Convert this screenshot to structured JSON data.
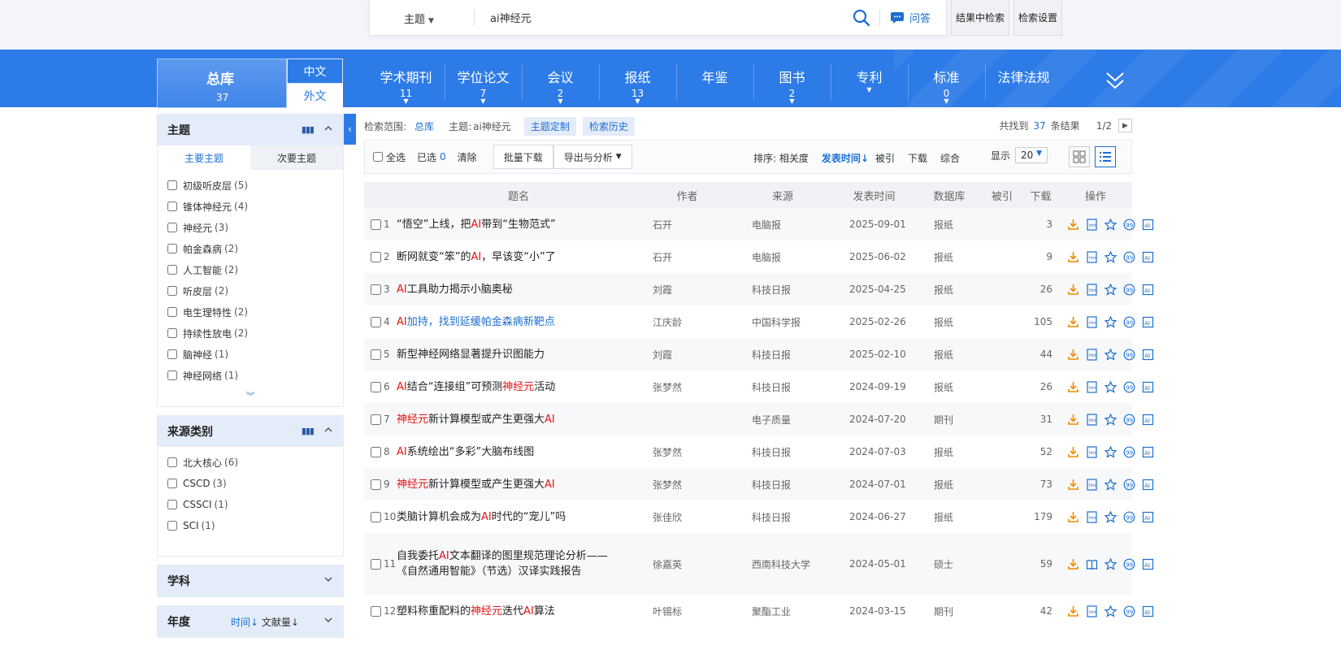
{
  "search": {
    "field": "主题",
    "query": "ai神经元",
    "qa_label": "问答",
    "in_results_label": "结果中检索",
    "settings_label": "检索设置"
  },
  "nav": {
    "all": {
      "name": "总库",
      "count": "37"
    },
    "lang_zh": "中文",
    "lang_en": "外文",
    "tabs": [
      {
        "name": "学术期刊",
        "count": "11"
      },
      {
        "name": "学位论文",
        "count": "7"
      },
      {
        "name": "会议",
        "count": "2"
      },
      {
        "name": "报纸",
        "count": "13"
      },
      {
        "name": "年鉴",
        "count": ""
      },
      {
        "name": "图书",
        "count": "2"
      },
      {
        "name": "专利",
        "count": ""
      },
      {
        "name": "标准",
        "count": "0"
      },
      {
        "name": "法律法规",
        "count": ""
      }
    ]
  },
  "left": {
    "topic": {
      "title": "主题",
      "tab_main": "主要主题",
      "tab_secondary": "次要主题",
      "items": [
        {
          "label": "初级听皮层",
          "count": "(5)"
        },
        {
          "label": "锥体神经元",
          "count": "(4)"
        },
        {
          "label": "神经元",
          "count": "(3)"
        },
        {
          "label": "帕金森病",
          "count": "(2)"
        },
        {
          "label": "人工智能",
          "count": "(2)"
        },
        {
          "label": "听皮层",
          "count": "(2)"
        },
        {
          "label": "电生理特性",
          "count": "(2)"
        },
        {
          "label": "持续性放电",
          "count": "(2)"
        },
        {
          "label": "脑神经",
          "count": "(1)"
        },
        {
          "label": "神经网络",
          "count": "(1)"
        }
      ]
    },
    "source": {
      "title": "来源类别",
      "items": [
        {
          "label": "北大核心",
          "count": "(6)"
        },
        {
          "label": "CSCD",
          "count": "(3)"
        },
        {
          "label": "CSSCI",
          "count": "(1)"
        },
        {
          "label": "SCI",
          "count": "(1)"
        }
      ]
    },
    "subject": {
      "title": "学科"
    },
    "year": {
      "title": "年度",
      "sort_time": "时间↓",
      "sort_count": "文献量↓"
    }
  },
  "main": {
    "crumbs": {
      "scope_label": "检索范围:",
      "scope_value": "总库",
      "topic_label": "主题:",
      "topic_value": "ai神经元",
      "tag_custom": "主题定制",
      "tag_history": "检索历史"
    },
    "result_prefix": "共找到",
    "result_count": "37",
    "result_suffix": "条结果",
    "page": "1/2",
    "toolbar": {
      "select_all": "全选",
      "selected_label": "已选",
      "selected_count": "0",
      "clear": "清除",
      "batch_download": "批量下载",
      "export": "导出与分析",
      "sort_label": "排序:",
      "sort_relevance": "相关度",
      "sort_date": "发表时间",
      "sort_cited": "被引",
      "sort_download": "下载",
      "sort_overall": "综合",
      "display_label": "显示",
      "display_value": "20"
    },
    "columns": [
      "题名",
      "作者",
      "来源",
      "发表时间",
      "数据库",
      "被引",
      "下载",
      "操作"
    ],
    "rows": [
      {
        "idx": "1",
        "title": [
          {
            "t": "“悟空”上线，把"
          },
          {
            "t": "AI",
            "hl": true
          },
          {
            "t": "带到“生物范式”"
          }
        ],
        "author": "石开",
        "source": "电脑报",
        "date": "2025-09-01",
        "db": "报纸",
        "cited": "",
        "downloads": "3"
      },
      {
        "idx": "2",
        "title": [
          {
            "t": "断网就变“笨”的"
          },
          {
            "t": "AI",
            "hl": true
          },
          {
            "t": "，早该变“小”了"
          }
        ],
        "author": "石开",
        "source": "电脑报",
        "date": "2025-06-02",
        "db": "报纸",
        "cited": "",
        "downloads": "9"
      },
      {
        "idx": "3",
        "title": [
          {
            "t": "AI",
            "hl": true
          },
          {
            "t": "工具助力揭示小脑奥秘"
          }
        ],
        "author": "刘霞",
        "source": "科技日报",
        "date": "2025-04-25",
        "db": "报纸",
        "cited": "",
        "downloads": "26"
      },
      {
        "idx": "4",
        "title": [
          {
            "t": "AI",
            "hl": true
          },
          {
            "t": "加持，找到延缓帕金森病新靶点"
          }
        ],
        "title_blue": true,
        "author": "江庆龄",
        "source": "中国科学报",
        "date": "2025-02-26",
        "db": "报纸",
        "cited": "",
        "downloads": "105"
      },
      {
        "idx": "5",
        "title": [
          {
            "t": "新型神经网络显著提升识图能力"
          }
        ],
        "author": "刘霞",
        "source": "科技日报",
        "date": "2025-02-10",
        "db": "报纸",
        "cited": "",
        "downloads": "44"
      },
      {
        "idx": "6",
        "title": [
          {
            "t": "AI",
            "hl": true
          },
          {
            "t": "结合“连接组”可预测"
          },
          {
            "t": "神经元",
            "hl": true
          },
          {
            "t": "活动"
          }
        ],
        "author": "张梦然",
        "source": "科技日报",
        "date": "2024-09-19",
        "db": "报纸",
        "cited": "",
        "downloads": "26"
      },
      {
        "idx": "7",
        "title": [
          {
            "t": "神经元",
            "hl": true
          },
          {
            "t": "新计算模型或产生更强大"
          },
          {
            "t": "AI",
            "hl": true
          }
        ],
        "author": "",
        "source": "电子质量",
        "date": "2024-07-20",
        "db": "期刊",
        "cited": "",
        "downloads": "31"
      },
      {
        "idx": "8",
        "title": [
          {
            "t": "AI",
            "hl": true
          },
          {
            "t": "系统绘出“多彩”大脑布线图"
          }
        ],
        "author": "张梦然",
        "source": "科技日报",
        "date": "2024-07-03",
        "db": "报纸",
        "cited": "",
        "downloads": "52"
      },
      {
        "idx": "9",
        "title": [
          {
            "t": "神经元",
            "hl": true
          },
          {
            "t": "新计算模型或产生更强大"
          },
          {
            "t": "AI",
            "hl": true
          }
        ],
        "author": "张梦然",
        "source": "科技日报",
        "date": "2024-07-01",
        "db": "报纸",
        "cited": "",
        "downloads": "73"
      },
      {
        "idx": "10",
        "title": [
          {
            "t": "类脑计算机会成为"
          },
          {
            "t": "AI",
            "hl": true
          },
          {
            "t": "时代的“宠儿”吗"
          }
        ],
        "author": "张佳欣",
        "source": "科技日报",
        "date": "2024-06-27",
        "db": "报纸",
        "cited": "",
        "downloads": "179"
      },
      {
        "idx": "11",
        "title": [
          {
            "t": "自我委托"
          },
          {
            "t": "AI",
            "hl": true
          },
          {
            "t": "文本翻译的图里规范理论分析——《自然通用智能》（节选）汉译实践报告"
          }
        ],
        "author": "徐嘉英",
        "source": "西南科技大学",
        "date": "2024-05-01",
        "db": "硕士",
        "cited": "",
        "downloads": "59",
        "tall": true
      },
      {
        "idx": "12",
        "title": [
          {
            "t": "塑料称重配料的"
          },
          {
            "t": "神经元",
            "hl": true
          },
          {
            "t": "迭代"
          },
          {
            "t": "AI",
            "hl": true
          },
          {
            "t": "算法"
          }
        ],
        "author": "叶锡标",
        "source": "聚酯工业",
        "date": "2024-03-15",
        "db": "期刊",
        "cited": "",
        "downloads": "42"
      }
    ]
  },
  "colors": {
    "brand": "#2d7be7",
    "link": "#1d6fcf",
    "highlight": "#e51414",
    "download_icon": "#f08a00"
  }
}
